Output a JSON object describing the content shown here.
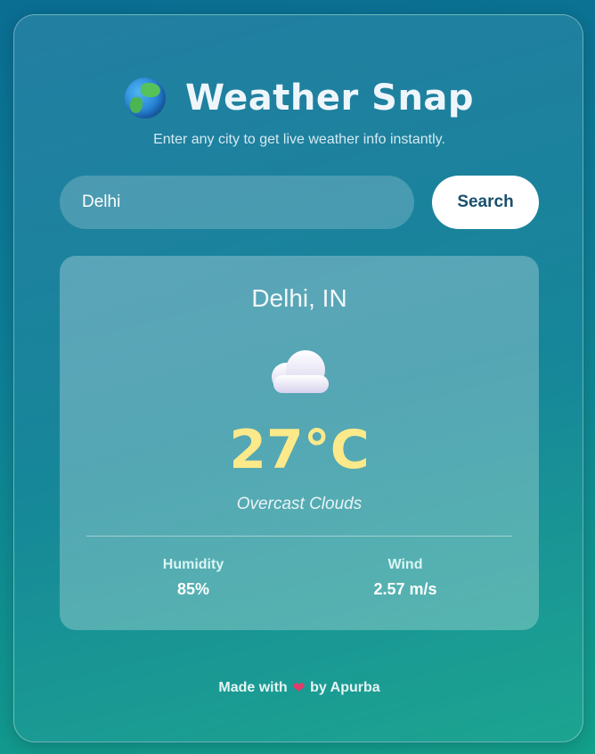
{
  "app": {
    "title": "Weather Snap",
    "subtitle": "Enter any city to get live weather info instantly.",
    "logo_icon": "globe-icon"
  },
  "search": {
    "value": "Delhi",
    "button_label": "Search"
  },
  "weather": {
    "location": "Delhi, IN",
    "condition_icon": "cloud-icon",
    "temperature": "27°C",
    "description": "Overcast Clouds",
    "humidity_label": "Humidity",
    "humidity_value": "85%",
    "wind_label": "Wind",
    "wind_value": "2.57 m/s"
  },
  "footer": {
    "prefix": "Made with",
    "heart_icon": "heart-icon",
    "suffix": "by Apurba"
  },
  "colors": {
    "temperature": "#fbe98a",
    "button_text": "#1a4f6b",
    "heart": "#e23a6a"
  }
}
